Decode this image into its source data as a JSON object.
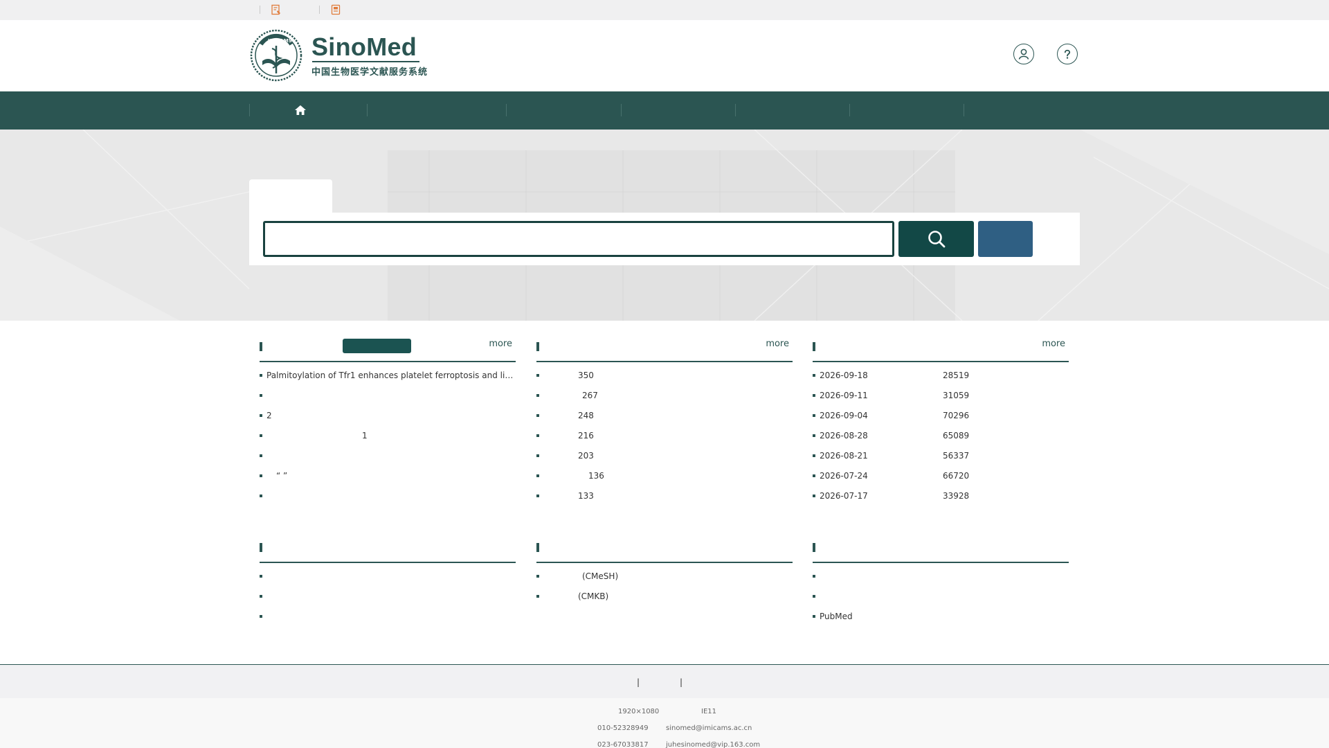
{
  "header": {
    "logo_title": "SinoMed",
    "logo_subtitle": "中国生物医学文献服务系统",
    "seal_text": "IMICAMS"
  },
  "panels": {
    "left_top": {
      "more": "more",
      "items": [
        "Palmitoylation of Tfr1 enhances platelet ferroptosis and liver injury in heat stroke",
        "",
        "2",
        "1",
        "",
        "“ ”",
        ""
      ]
    },
    "mid_top": {
      "more": "more",
      "items": [
        {
          "num": "350",
          "offset": 0
        },
        {
          "num": "267",
          "offset": 6
        },
        {
          "num": "248",
          "offset": 0
        },
        {
          "num": "216",
          "offset": 0
        },
        {
          "num": "203",
          "offset": 0
        },
        {
          "num": "136",
          "offset": 15
        },
        {
          "num": "133",
          "offset": 0
        }
      ]
    },
    "right_top": {
      "more": "more",
      "items": [
        {
          "date": "2026-09-18",
          "count": "28519"
        },
        {
          "date": "2026-09-11",
          "count": "31059"
        },
        {
          "date": "2026-09-04",
          "count": "70296"
        },
        {
          "date": "2026-08-28",
          "count": "65089"
        },
        {
          "date": "2026-08-21",
          "count": "56337"
        },
        {
          "date": "2026-07-24",
          "count": "66720"
        },
        {
          "date": "2026-07-17",
          "count": "33928"
        }
      ]
    },
    "left_bottom": {
      "items": [
        "",
        "",
        ""
      ]
    },
    "mid_bottom": {
      "items": [
        "(CMeSH)",
        "(CMKB)"
      ]
    },
    "right_bottom": {
      "items": [
        "",
        "",
        "PubMed"
      ]
    }
  },
  "footer": {
    "sep1": "|",
    "sep2": "|",
    "resolution": "1920×1080",
    "browser": "IE11",
    "phone1": "010-52328949",
    "email1": "sinomed@imicams.ac.cn",
    "phone2": "023-67033817",
    "email2": "juhesinomed@vip.163.com"
  },
  "colors": {
    "brand": "#2b5552",
    "search_button": "#124846",
    "advanced_button": "#2f5f83",
    "accent_icon": "#e07b3a"
  }
}
